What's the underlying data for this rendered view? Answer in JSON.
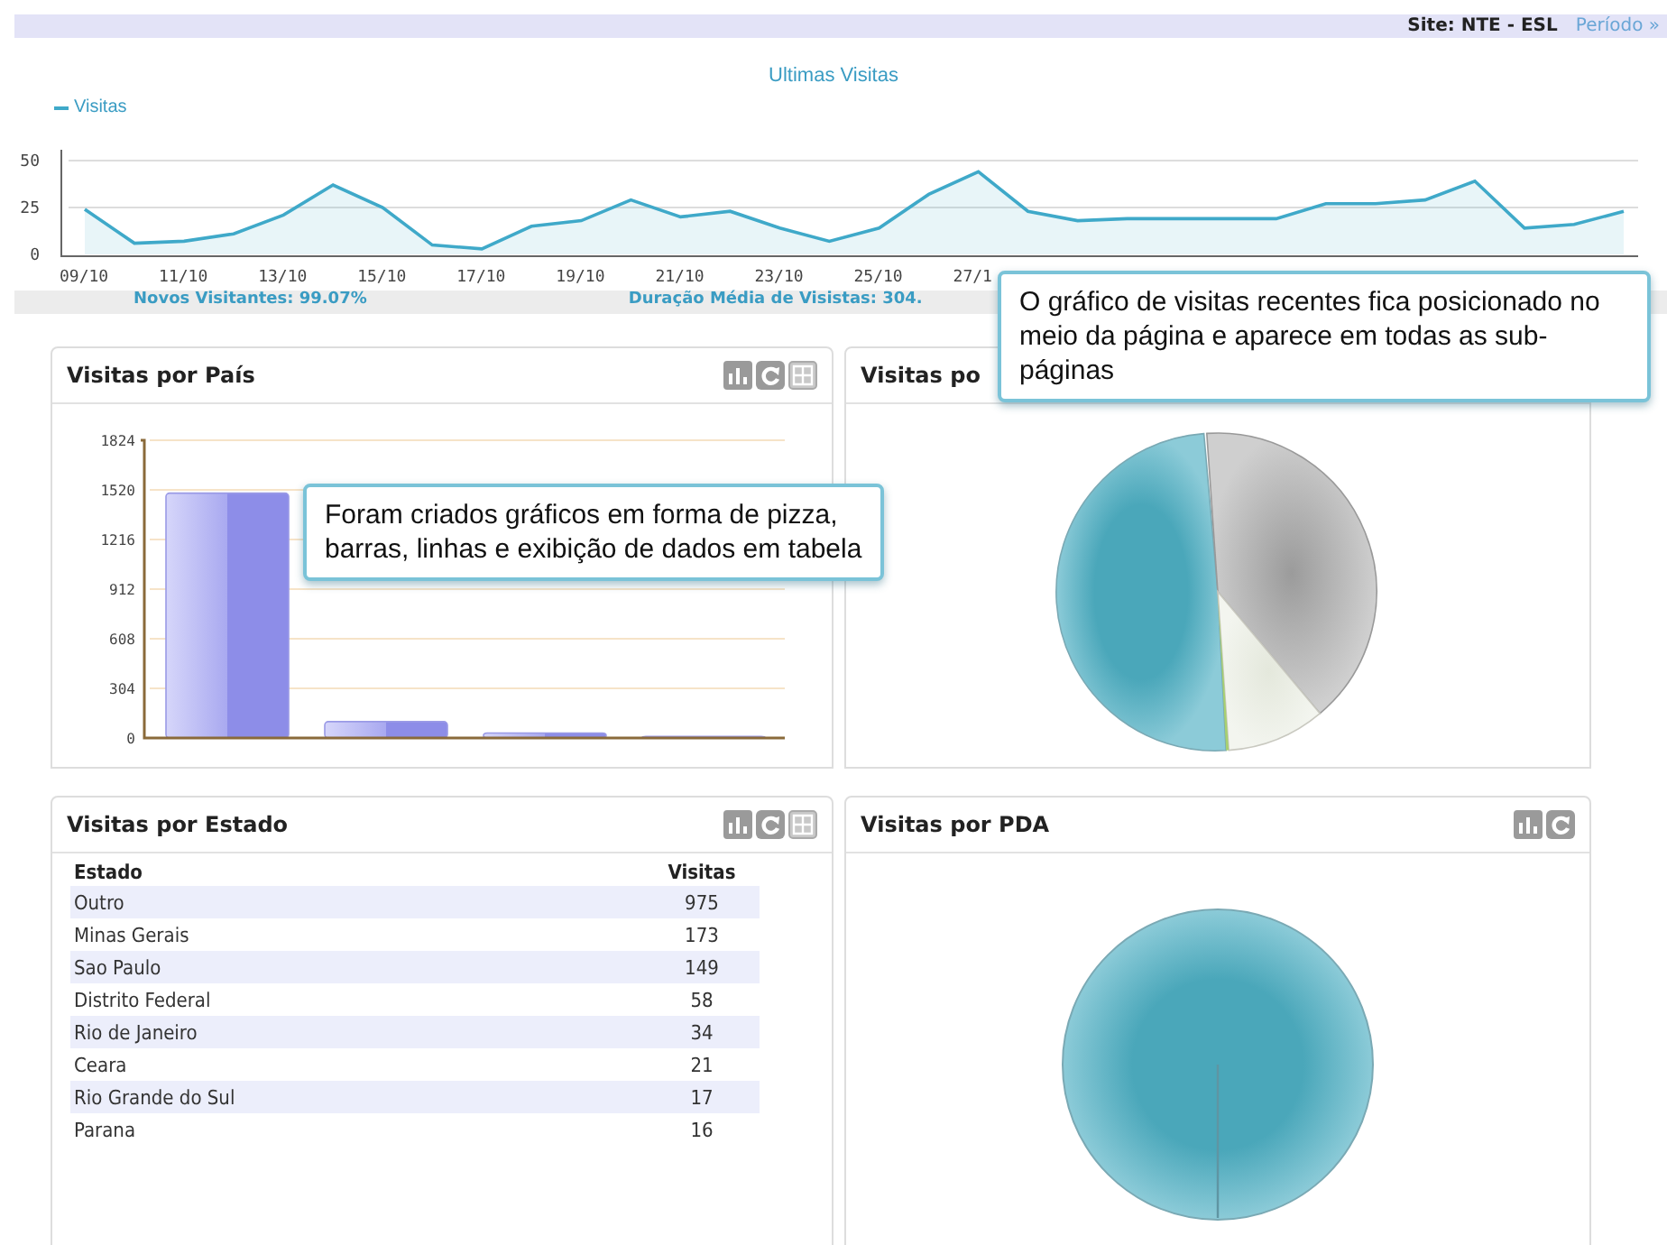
{
  "header": {
    "site": "Site: NTE - ESL",
    "period_link": "Período »"
  },
  "visits_chart": {
    "chart_data": {
      "type": "area",
      "title": "Ultimas Visitas",
      "grid": true,
      "categories": [
        "09/10",
        null,
        "11/10",
        null,
        "13/10",
        null,
        "15/10",
        null,
        "17/10",
        null,
        "19/10",
        null,
        "21/10",
        null,
        "23/10",
        null,
        "25/10",
        null,
        "27/1",
        null,
        null,
        null,
        null,
        null,
        null,
        null,
        null,
        null,
        null,
        null,
        null,
        null
      ],
      "series": [
        {
          "name": "Visitas",
          "color": "#3fa9c9",
          "values": [
            24,
            6,
            7,
            11,
            21,
            37,
            25,
            5,
            3,
            15,
            18,
            29,
            20,
            23,
            14,
            7,
            14,
            32,
            44,
            23,
            18,
            19,
            19,
            19,
            19,
            27,
            27,
            29,
            39,
            14,
            16,
            23
          ]
        }
      ],
      "ylim": [
        0,
        50
      ],
      "yticks": [
        0,
        25,
        50
      ]
    }
  },
  "stats": [
    "Novos Visitantes: 99.07%",
    "Duração Média de Visistas: 304."
  ],
  "panels": [
    {
      "kind": "bar",
      "title": "Visitas por País",
      "tools": [
        {
          "kind": "bar"
        },
        {
          "kind": "refresh"
        },
        {
          "kind": "table"
        }
      ],
      "chart_data": {
        "type": "bar",
        "grid": true,
        "values": [
          1500,
          100,
          30,
          10
        ],
        "ylim": [
          0,
          1824
        ],
        "yticks": [
          0,
          304,
          608,
          912,
          1216,
          1520,
          1824
        ]
      }
    },
    {
      "kind": "pie",
      "title": "Visitas po"
    },
    {
      "kind": "table",
      "title": "Visitas por Estado",
      "tools": [
        {
          "kind": "bar"
        },
        {
          "kind": "refresh"
        },
        {
          "kind": "table"
        }
      ],
      "columns": [
        "Estado",
        "Visitas"
      ],
      "rows": [
        [
          "Outro",
          "975"
        ],
        [
          "Minas Gerais",
          "173"
        ],
        [
          "Sao Paulo",
          "149"
        ],
        [
          "Distrito Federal",
          "58"
        ],
        [
          "Rio de Janeiro",
          "34"
        ],
        [
          "Ceara",
          "21"
        ],
        [
          "Rio Grande do Sul",
          "17"
        ],
        [
          "Parana",
          "16"
        ]
      ]
    },
    {
      "kind": "disc",
      "title": "Visitas por PDA",
      "tools": [
        {
          "kind": "bar"
        },
        {
          "kind": "refresh"
        }
      ]
    }
  ],
  "callouts": [
    {
      "text": "Foram criados gráficos em forma de pizza, barras, linhas e exibição de dados em tabela"
    },
    {
      "text": "O gráfico de visitas recentes fica posicionado no meio da página e aparece em todas as sub-páginas"
    }
  ]
}
